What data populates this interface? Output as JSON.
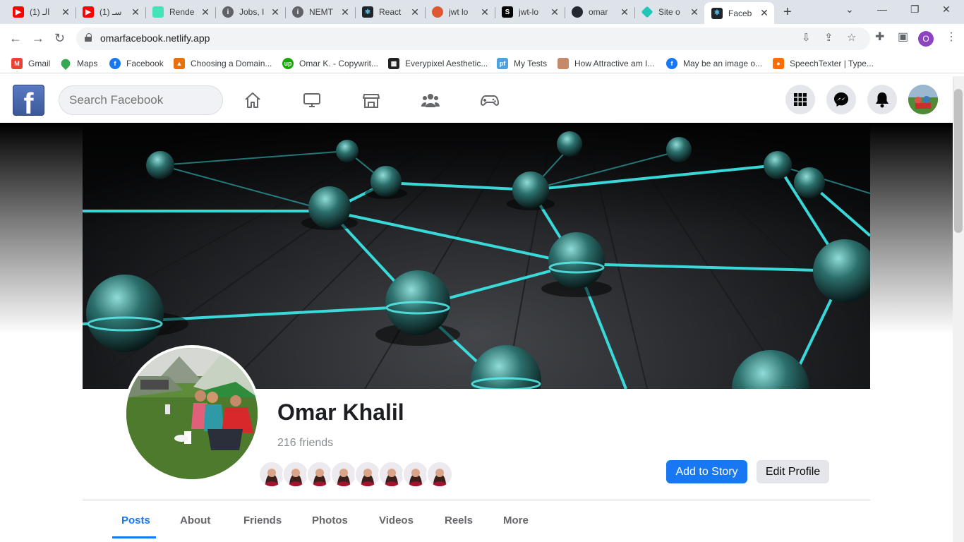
{
  "browser": {
    "tabs": [
      {
        "title": "(1) الـ",
        "favicon": "youtube-icon",
        "color": "#ff0000"
      },
      {
        "title": "(1) سـ",
        "favicon": "youtube-icon",
        "color": "#ff0000"
      },
      {
        "title": "Rende",
        "favicon": "render-icon",
        "color": "#46e3b7"
      },
      {
        "title": "Jobs, I",
        "favicon": "info-icon",
        "color": "#5f6368"
      },
      {
        "title": "NEMT",
        "favicon": "info-icon",
        "color": "#5f6368"
      },
      {
        "title": "React",
        "favicon": "react-icon",
        "color": "#20232a"
      },
      {
        "title": "jwt lo",
        "favicon": "duckduckgo-icon",
        "color": "#de5833"
      },
      {
        "title": "jwt-lo",
        "favicon": "s-icon",
        "color": "#000000"
      },
      {
        "title": "omar",
        "favicon": "github-icon",
        "color": "#24292f"
      },
      {
        "title": "Site o",
        "favicon": "netlify-icon",
        "color": "#20c6b7"
      },
      {
        "title": "Faceb",
        "favicon": "react-icon",
        "color": "#20232a",
        "active": true
      }
    ],
    "url": "omarfacebook.netlify.app",
    "profile_initial": "O",
    "bookmarks": [
      {
        "label": "Gmail",
        "icon": "gmail-icon",
        "color": "#ea4335"
      },
      {
        "label": "Maps",
        "icon": "maps-icon",
        "color": "#34a853"
      },
      {
        "label": "Facebook",
        "icon": "facebook-icon",
        "color": "#1877f2"
      },
      {
        "label": "Choosing a Domain...",
        "icon": "triangle-icon",
        "color": "#e8710a"
      },
      {
        "label": "Omar K. - Copywrit...",
        "icon": "upwork-icon",
        "color": "#14a800"
      },
      {
        "label": "Everypixel Aesthetic...",
        "icon": "everypixel-icon",
        "color": "#222222"
      },
      {
        "label": "My Tests",
        "icon": "pf-icon",
        "color": "#4aa3df"
      },
      {
        "label": "How Attractive am I...",
        "icon": "face-icon",
        "color": "#c48a6a"
      },
      {
        "label": "May be an image o...",
        "icon": "facebook-icon",
        "color": "#1877f2"
      },
      {
        "label": "SpeechTexter | Type...",
        "icon": "mic-icon",
        "color": "#ff6d00"
      }
    ]
  },
  "fb": {
    "logo_letter": "f",
    "search_placeholder": "Search Facebook",
    "profile": {
      "name": "Omar Khalil",
      "friends": "216 friends"
    },
    "buttons": {
      "add_story": "Add to Story",
      "edit_profile": "Edit Profile"
    },
    "tabs": [
      "Posts",
      "About",
      "Friends",
      "Photos",
      "Videos",
      "Reels",
      "More"
    ],
    "accent": "#1877f2"
  }
}
